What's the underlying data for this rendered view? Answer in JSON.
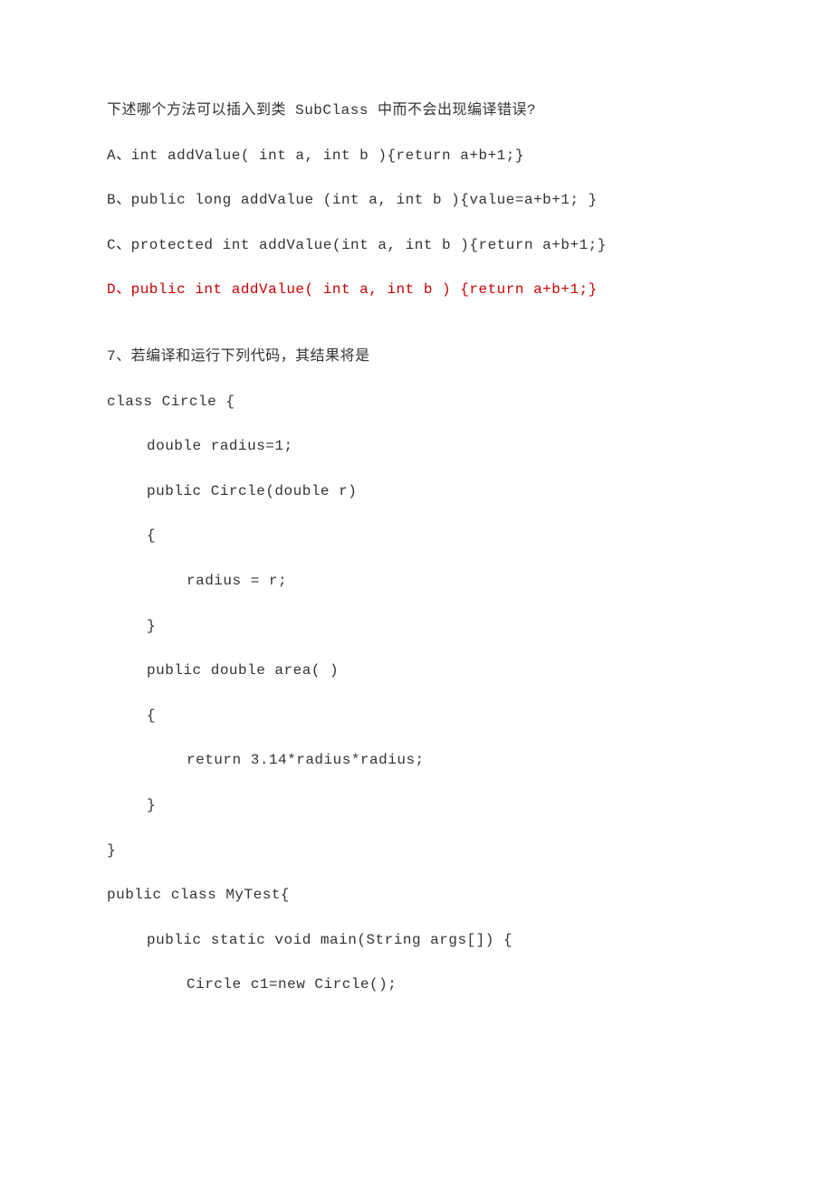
{
  "q6": {
    "stem": "下述哪个方法可以插入到类 SubClass 中而不会出现编译错误?",
    "optA": "A、int addValue( int a, int b ){return a+b+1;}",
    "optB": "B、public long addValue (int a, int b ){value=a+b+1; }",
    "optC": "C、protected int addValue(int a, int b ){return a+b+1;}",
    "optD": "D、public int addValue( int a, int b ) {return a+b+1;}"
  },
  "q7": {
    "stem": "7、若编译和运行下列代码，其结果将是",
    "code": {
      "l1": "class Circle {",
      "l2": "double radius=1;",
      "l3": "public Circle(double r)",
      "l4": "{",
      "l5": "radius = r;",
      "l6": "}",
      "l7": "public double area( )",
      "l8": "{",
      "l9": "return 3.14*radius*radius;",
      "l10": "}",
      "l11": "}",
      "l12": "public class MyTest{",
      "l13": "public static void main(String args[]) {",
      "l14": "Circle c1=new Circle();"
    }
  }
}
